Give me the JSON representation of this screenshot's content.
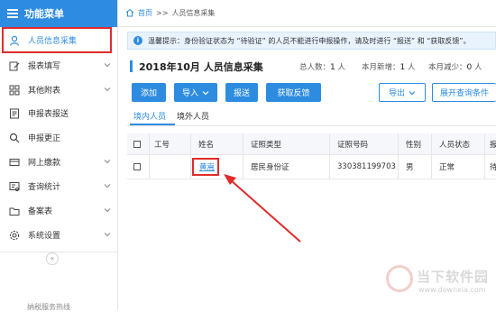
{
  "sidebar": {
    "header_title": "功能菜单",
    "items": [
      {
        "label": "人员信息采集",
        "icon": "person-icon",
        "has_chevron": false
      },
      {
        "label": "报表填写",
        "icon": "edit-icon",
        "has_chevron": true
      },
      {
        "label": "其他附表",
        "icon": "grid-icon",
        "has_chevron": true
      },
      {
        "label": "申报表报送",
        "icon": "report-send-icon",
        "has_chevron": false
      },
      {
        "label": "申报更正",
        "icon": "search-icon",
        "has_chevron": false
      },
      {
        "label": "网上缴款",
        "icon": "card-icon",
        "has_chevron": true
      },
      {
        "label": "查询统计",
        "icon": "query-icon",
        "has_chevron": true
      },
      {
        "label": "备案表",
        "icon": "folder-icon",
        "has_chevron": true
      },
      {
        "label": "系统设置",
        "icon": "gear-icon",
        "has_chevron": true
      }
    ],
    "collapse_label": "«",
    "footer_text": "纳税服务热线"
  },
  "breadcrumb": {
    "home": "首页",
    "separator": ">>",
    "current": "人员信息采集"
  },
  "notice": {
    "text": "温馨提示：身份验证状态为 “待验证” 的人员不能进行申报操作，请及时进行 “报送” 和 “获取反馈”。"
  },
  "summary": {
    "title": "2018年10月  人员信息采集",
    "total_label": "总人数：",
    "total_value": "1",
    "total_unit": "人",
    "new_label": "本月新增：",
    "new_value": "1",
    "new_unit": "人",
    "reduce_label": "本月减少：",
    "reduce_value": "0",
    "reduce_unit": "人"
  },
  "toolbar": {
    "add": "添加",
    "import": "导入",
    "submit": "报送",
    "feedback": "获取反馈",
    "export": "导出",
    "expand_query": "展开查询条件"
  },
  "tabs": [
    "境内人员",
    "境外人员"
  ],
  "table": {
    "headers": [
      "工号",
      "姓名",
      "证照类型",
      "证照号码",
      "性别",
      "人员状态",
      "报"
    ],
    "rows": [
      {
        "id": "",
        "name": "黄嵩",
        "id_type": "居民身份证",
        "id_number": "330381199703...",
        "gender": "男",
        "status": "正常",
        "extra": "待"
      }
    ]
  },
  "watermark": {
    "title": "当下软件园",
    "url": "www.downxia.com"
  },
  "colors": {
    "accent": "#2d8ce0",
    "annotation_red": "#e02b2b"
  }
}
